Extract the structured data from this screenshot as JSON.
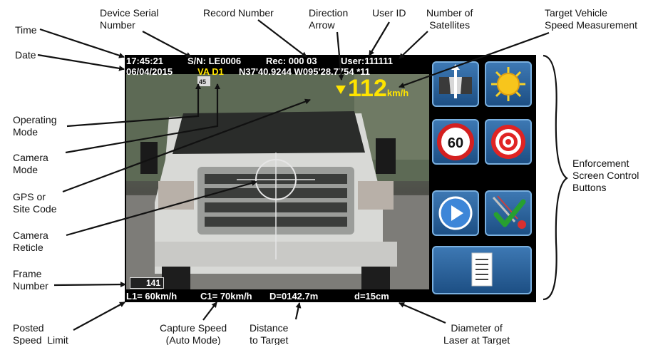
{
  "annotations": {
    "time": "Time",
    "date": "Date",
    "device_serial": "Device Serial\nNumber",
    "record_number": "Record Number",
    "direction_arrow": "Direction\nArrow",
    "user_id": "User ID",
    "satellites": "Number of\nSatellites",
    "target_speed": "Target Vehicle\nSpeed Measurement",
    "operating_mode": "Operating\nMode",
    "camera_mode": "Camera\nMode",
    "gps_site": "GPS or\nSite Code",
    "camera_reticle": "Camera\nReticle",
    "frame_number": "Frame\nNumber",
    "enforcement_buttons": "Enforcement\nScreen Control\nButtons",
    "posted_speed": "Posted\nSpeed  Limit",
    "capture_speed": "Capture Speed\n(Auto Mode)",
    "distance": "Distance\nto Target",
    "diameter": "Diameter of\nLaser at Target"
  },
  "screen": {
    "time": "17:45:21",
    "serial": "S/N: LE0006",
    "record": "Rec: 000 03",
    "user": "User:111111",
    "date": "06/04/2015",
    "mode": "VA D1",
    "gps": "N37'40.9244 W095'28.7754 *11",
    "speed": "112",
    "speed_unit": "km/h",
    "frame": "141",
    "posted_limit": "L1= 60km/h",
    "capture_speed": "C1= 70km/h",
    "distance": "D=0142.7m",
    "diameter": "d=15cm",
    "speed_sign_value": "60",
    "sign_plate": "45"
  },
  "colors": {
    "hud_yellow": "#ffe400",
    "button_blue": "#2a63a0",
    "button_border": "#7ab0e0"
  },
  "buttons": [
    "road-view",
    "brightness",
    "speed-limit",
    "target",
    "play",
    "accept",
    "menu"
  ]
}
